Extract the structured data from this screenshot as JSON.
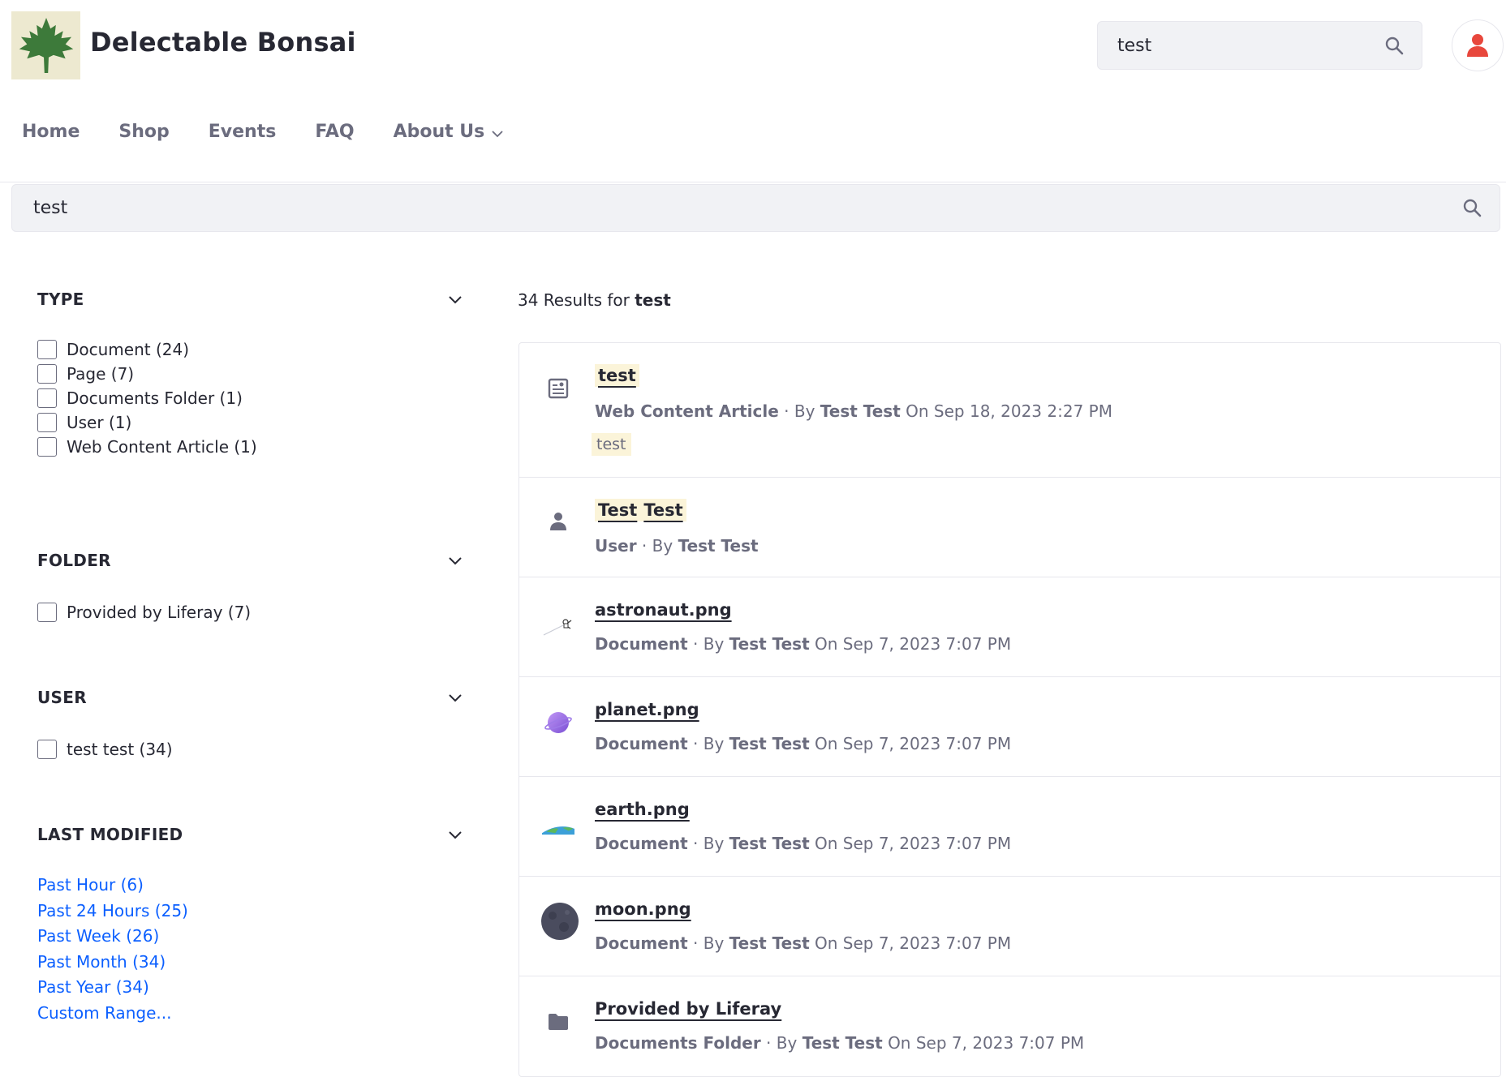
{
  "header": {
    "site_name": "Delectable Bonsai",
    "search_value": "test",
    "icons": {
      "logo": "maple-leaf-icon",
      "search": "search-icon",
      "avatar": "user-icon"
    },
    "colors": {
      "logo_bg": "#ede9d0",
      "leaf": "#3d7a3a",
      "avatar": "#e8473c"
    }
  },
  "nav": {
    "items": [
      {
        "label": "Home"
      },
      {
        "label": "Shop"
      },
      {
        "label": "Events"
      },
      {
        "label": "FAQ"
      },
      {
        "label": "About Us",
        "has_dropdown": true
      }
    ]
  },
  "main_search": {
    "value": "test"
  },
  "facets": {
    "type": {
      "title": "TYPE",
      "options": [
        "Document (24)",
        "Page (7)",
        "Documents Folder (1)",
        "User (1)",
        "Web Content Article (1)"
      ]
    },
    "folder": {
      "title": "FOLDER",
      "options": [
        "Provided by Liferay (7)"
      ]
    },
    "user": {
      "title": "USER",
      "options": [
        "test test (34)"
      ]
    },
    "last_modified": {
      "title": "LAST MODIFIED",
      "links": [
        "Past Hour (6)",
        "Past 24 Hours (25)",
        "Past Week (26)",
        "Past Month (34)",
        "Past Year (34)",
        "Custom Range..."
      ]
    }
  },
  "results": {
    "count_text": "34 Results for",
    "query": "test",
    "items": [
      {
        "title": "test",
        "type": "Web Content Article",
        "by": "By",
        "author": "Test Test",
        "date": "On Sep 18, 2023 2:27 PM",
        "snippet": "test",
        "icon": "web-content-article-icon"
      },
      {
        "title_parts": [
          "Test",
          "Test"
        ],
        "type": "User",
        "by": "By",
        "author": "Test Test",
        "icon": "user-icon"
      },
      {
        "title": "astronaut.png",
        "type": "Document",
        "by": "By",
        "author": "Test Test",
        "date": "On Sep 7, 2023 7:07 PM",
        "icon": "astronaut-thumbnail"
      },
      {
        "title": "planet.png",
        "type": "Document",
        "by": "By",
        "author": "Test Test",
        "date": "On Sep 7, 2023 7:07 PM",
        "icon": "planet-thumbnail"
      },
      {
        "title": "earth.png",
        "type": "Document",
        "by": "By",
        "author": "Test Test",
        "date": "On Sep 7, 2023 7:07 PM",
        "icon": "earth-thumbnail"
      },
      {
        "title": "moon.png",
        "type": "Document",
        "by": "By",
        "author": "Test Test",
        "date": "On Sep 7, 2023 7:07 PM",
        "icon": "moon-thumbnail"
      },
      {
        "title": "Provided by Liferay",
        "type": "Documents Folder",
        "by": "By",
        "author": "Test Test",
        "date": "On Sep 7, 2023 7:07 PM",
        "icon": "folder-icon"
      }
    ]
  }
}
